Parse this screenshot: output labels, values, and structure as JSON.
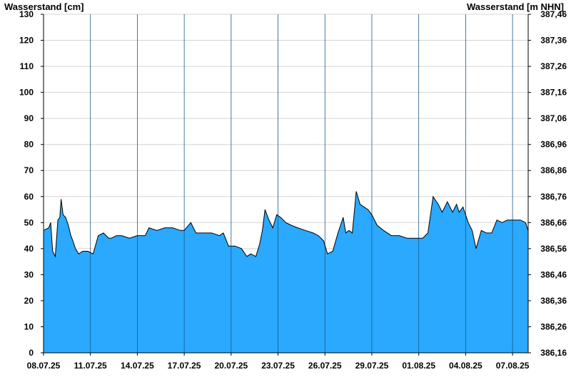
{
  "chart_data": {
    "type": "area",
    "left_axis_title": "Wasserstand [cm]",
    "right_axis_title": "Wasserstand [m NHN]",
    "ylim": [
      0,
      130
    ],
    "y_ticks": [
      0,
      10,
      20,
      30,
      40,
      50,
      60,
      70,
      80,
      90,
      100,
      110,
      120,
      130
    ],
    "y_ticks_right": [
      "386,16",
      "386,26",
      "386,36",
      "386,46",
      "386,56",
      "386,66",
      "386,76",
      "386,86",
      "386,96",
      "387,06",
      "387,16",
      "387,26",
      "387,36",
      "387,46"
    ],
    "xlim": [
      "2025-07-08",
      "2025-08-08"
    ],
    "x_ticks": [
      "2025-07-08",
      "2025-07-11",
      "2025-07-14",
      "2025-07-17",
      "2025-07-20",
      "2025-07-23",
      "2025-07-26",
      "2025-07-29",
      "2025-08-01",
      "2025-08-04",
      "2025-08-07"
    ],
    "x_tick_labels": [
      "08.07.25",
      "11.07.25",
      "14.07.25",
      "17.07.25",
      "20.07.25",
      "23.07.25",
      "26.07.25",
      "29.07.25",
      "01.08.25",
      "04.08.25",
      "07.08.25"
    ],
    "grid": true,
    "fill_color": "#2aa9ff",
    "line_color": "#000000",
    "series": [
      {
        "x": [
          "2025-07-08 00:00",
          "2025-07-08 08:00",
          "2025-07-08 11:00",
          "2025-07-08 14:00",
          "2025-07-08 18:00",
          "2025-07-08 22:00",
          "2025-07-09 01:00",
          "2025-07-09 03:00",
          "2025-07-09 06:00",
          "2025-07-09 10:00",
          "2025-07-09 14:00",
          "2025-07-09 18:00",
          "2025-07-09 21:00",
          "2025-07-10 01:00",
          "2025-07-10 06:00",
          "2025-07-10 12:00",
          "2025-07-10 20:00",
          "2025-07-11 04:00",
          "2025-07-11 12:00",
          "2025-07-11 20:00",
          "2025-07-12 04:00",
          "2025-07-12 08:00",
          "2025-07-12 16:00",
          "2025-07-13 00:00",
          "2025-07-13 12:00",
          "2025-07-14 00:00",
          "2025-07-14 12:00",
          "2025-07-14 18:00",
          "2025-07-15 06:00",
          "2025-07-15 18:00",
          "2025-07-16 06:00",
          "2025-07-16 18:00",
          "2025-07-17 00:00",
          "2025-07-17 10:00",
          "2025-07-17 18:00",
          "2025-07-18 06:00",
          "2025-07-18 18:00",
          "2025-07-19 06:00",
          "2025-07-19 12:00",
          "2025-07-19 20:00",
          "2025-07-20 06:00",
          "2025-07-20 16:00",
          "2025-07-21 00:00",
          "2025-07-21 06:00",
          "2025-07-21 14:00",
          "2025-07-21 20:00",
          "2025-07-22 00:00",
          "2025-07-22 04:00",
          "2025-07-22 10:00",
          "2025-07-22 16:00",
          "2025-07-22 22:00",
          "2025-07-23 04:00",
          "2025-07-23 12:00",
          "2025-07-23 20:00",
          "2025-07-24 06:00",
          "2025-07-24 18:00",
          "2025-07-25 06:00",
          "2025-07-25 14:00",
          "2025-07-25 22:00",
          "2025-07-26 04:00",
          "2025-07-26 12:00",
          "2025-07-26 20:00",
          "2025-07-27 04:00",
          "2025-07-27 08:00",
          "2025-07-27 13:00",
          "2025-07-27 18:00",
          "2025-07-28 00:00",
          "2025-07-28 06:00",
          "2025-07-28 12:00",
          "2025-07-28 18:00",
          "2025-07-29 00:00",
          "2025-07-29 08:00",
          "2025-07-29 18:00",
          "2025-07-30 06:00",
          "2025-07-30 18:00",
          "2025-07-31 06:00",
          "2025-07-31 18:00",
          "2025-08-01 00:00",
          "2025-08-01 06:00",
          "2025-08-01 14:00",
          "2025-08-01 22:00",
          "2025-08-02 06:00",
          "2025-08-02 12:00",
          "2025-08-02 20:00",
          "2025-08-03 04:00",
          "2025-08-03 10:00",
          "2025-08-03 14:00",
          "2025-08-03 20:00",
          "2025-08-04 04:00",
          "2025-08-04 10:00",
          "2025-08-04 16:00",
          "2025-08-05 00:00",
          "2025-08-05 08:00",
          "2025-08-05 16:00",
          "2025-08-06 00:00",
          "2025-08-06 08:00",
          "2025-08-06 16:00",
          "2025-08-07 00:00",
          "2025-08-07 12:00",
          "2025-08-07 20:00",
          "2025-08-08 00:00"
        ],
        "values": [
          47,
          48,
          50,
          39,
          37,
          51,
          52,
          59,
          53,
          52,
          49,
          45,
          43,
          40,
          38,
          39,
          39,
          38,
          45,
          46,
          44,
          44,
          45,
          45,
          44,
          45,
          45,
          48,
          47,
          48,
          48,
          47,
          47,
          50,
          46,
          46,
          46,
          45,
          46,
          41,
          41,
          40,
          37,
          38,
          37,
          42,
          47,
          55,
          51,
          48,
          53,
          52,
          50,
          49,
          48,
          47,
          46,
          45,
          43,
          38,
          39,
          46,
          52,
          46,
          47,
          46,
          62,
          57,
          56,
          55,
          53,
          49,
          47,
          45,
          45,
          44,
          44,
          44,
          44,
          46,
          60,
          57,
          54,
          58,
          54,
          57,
          54,
          56,
          50,
          47,
          40,
          47,
          46,
          46,
          51,
          50,
          51,
          51,
          51,
          50,
          47
        ]
      }
    ]
  }
}
